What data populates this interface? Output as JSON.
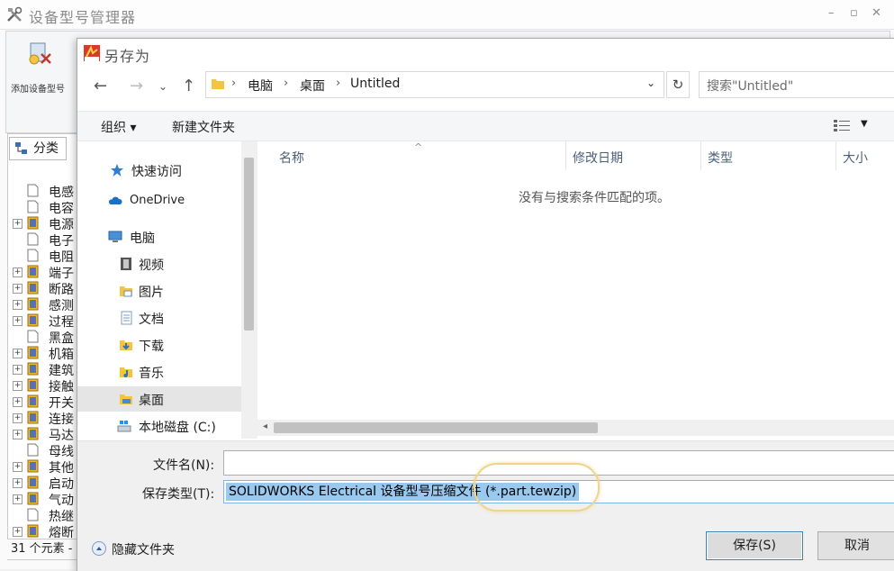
{
  "background_app": {
    "title": "设备型号管理器",
    "ribbon_add_label": "添加设备型号",
    "left_tab": "分类",
    "status": "31 个元素 -",
    "tree_items": [
      {
        "label": "电感",
        "expandable": false
      },
      {
        "label": "电容",
        "expandable": false
      },
      {
        "label": "电源",
        "expandable": true
      },
      {
        "label": "电子",
        "expandable": false
      },
      {
        "label": "电阻",
        "expandable": false
      },
      {
        "label": "端子",
        "expandable": true
      },
      {
        "label": "断路",
        "expandable": true
      },
      {
        "label": "感测",
        "expandable": true
      },
      {
        "label": "过程",
        "expandable": true
      },
      {
        "label": "黑盒",
        "expandable": false
      },
      {
        "label": "机箱",
        "expandable": true
      },
      {
        "label": "建筑",
        "expandable": true
      },
      {
        "label": "接触",
        "expandable": true
      },
      {
        "label": "开关",
        "expandable": true
      },
      {
        "label": "连接",
        "expandable": true
      },
      {
        "label": "马达",
        "expandable": true
      },
      {
        "label": "母线",
        "expandable": false
      },
      {
        "label": "其他",
        "expandable": true
      },
      {
        "label": "启动",
        "expandable": true
      },
      {
        "label": "气动",
        "expandable": true
      },
      {
        "label": "热继",
        "expandable": false
      },
      {
        "label": "熔断",
        "expandable": true
      }
    ]
  },
  "dialog": {
    "title": "另存为",
    "breadcrumb": [
      "电脑",
      "桌面",
      "Untitled"
    ],
    "search_placeholder": "搜索\"Untitled\"",
    "toolbar": {
      "organize_label": "组织 ▾",
      "new_folder_label": "新建文件夹"
    },
    "nav_items": [
      {
        "label": "快速访问",
        "icon": "star-icon"
      },
      {
        "label": "OneDrive",
        "icon": "cloud-icon"
      },
      {
        "label": "电脑",
        "icon": "computer-icon"
      },
      {
        "label": "视频",
        "icon": "video-folder-icon"
      },
      {
        "label": "图片",
        "icon": "pictures-folder-icon"
      },
      {
        "label": "文档",
        "icon": "documents-folder-icon"
      },
      {
        "label": "下载",
        "icon": "downloads-folder-icon"
      },
      {
        "label": "音乐",
        "icon": "music-folder-icon"
      },
      {
        "label": "桌面",
        "icon": "desktop-folder-icon"
      },
      {
        "label": "本地磁盘 (C:)",
        "icon": "drive-icon"
      }
    ],
    "selected_nav": "桌面",
    "columns": [
      "名称",
      "修改日期",
      "类型",
      "大小"
    ],
    "empty_message": "没有与搜索条件匹配的项。",
    "filename_label": "文件名(N):",
    "filename_value": "",
    "filetype_label": "保存类型(T):",
    "filetype_value": "SOLIDWORKS Electrical 设备型号压缩文件 (*.part.tewzip)",
    "hide_folders_label": "隐藏文件夹",
    "save_label": "保存(S)",
    "cancel_label": "取消"
  },
  "colors": {
    "selection": "#99c9ef",
    "highlight_ring": "#efd58a",
    "primary_button_border": "#3c7fb1"
  }
}
